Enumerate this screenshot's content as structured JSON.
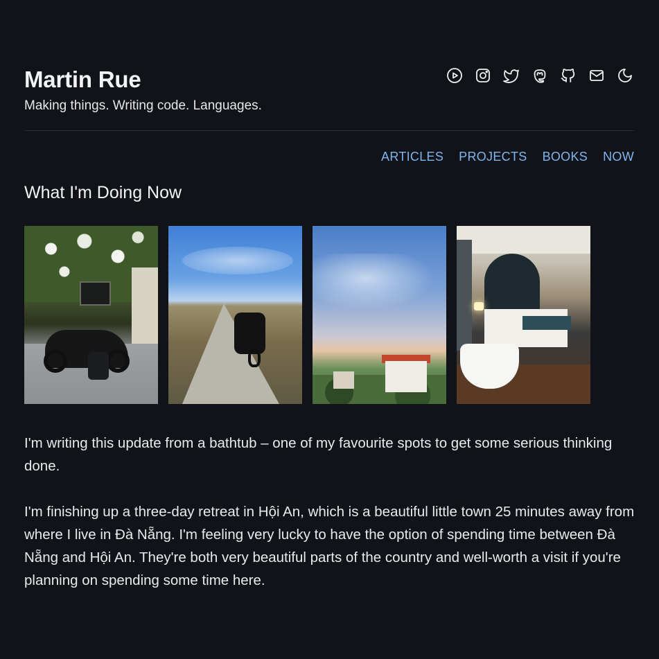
{
  "header": {
    "title": "Martin Rue",
    "tagline": "Making things. Writing code. Languages."
  },
  "social_icons": [
    "youtube-icon",
    "instagram-icon",
    "twitter-icon",
    "mastodon-icon",
    "github-icon",
    "mail-icon",
    "moon-icon"
  ],
  "nav": {
    "articles": "ARTICLES",
    "projects": "PROJECTS",
    "books": "BOOKS",
    "now": "NOW"
  },
  "section": {
    "title": "What I'm Doing Now"
  },
  "colors": {
    "background": "#111318",
    "text": "#e8eaed",
    "link": "#7eb6ef",
    "divider": "#2a2e35"
  },
  "content": {
    "paragraphs": [
      "I'm writing this update from a bathtub – one of my favourite spots to get some serious thinking done.",
      "I'm finishing up a three-day retreat in Hội An, which is a beautiful little town 25 minutes away from where I live in Đà Nẵng. I'm feeling very lucky to have the option of spending time between Đà Nẵng and Hội An. They're both very beautiful parts of the country and well-worth a visit if you're planning on spending some time here."
    ]
  }
}
